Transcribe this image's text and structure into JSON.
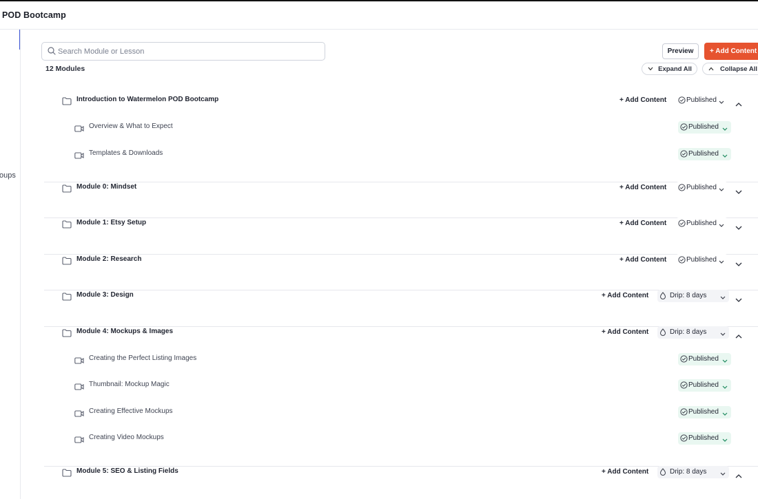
{
  "app": {
    "title": "POD Bootcamp"
  },
  "sidebar": {
    "partial_label": "oups"
  },
  "search": {
    "placeholder": "Search Module or Lesson"
  },
  "toolbar": {
    "preview_label": "Preview",
    "add_content_label": "+ Add Content"
  },
  "list": {
    "count_label": "12 Modules",
    "expand_all_label": "Expand All",
    "collapse_all_label": "Collapse All"
  },
  "colors": {
    "accent": "#e6532f",
    "published_bg": "#e9f7f1",
    "drip_bg": "#f3f4f7",
    "active_nav": "#3c55d6"
  },
  "modules": [
    {
      "title": "Introduction to Watermelon POD Bootcamp",
      "add_label": "+ Add Content",
      "status": "Published",
      "expanded": true,
      "lessons": [
        {
          "title": "Overview & What to Expect",
          "status": "Published"
        },
        {
          "title": "Templates & Downloads",
          "status": "Published"
        }
      ]
    },
    {
      "title": "Module 0: Mindset",
      "add_label": "+ Add Content",
      "status": "Published",
      "expanded": false
    },
    {
      "title": "Module 1: Etsy Setup",
      "add_label": "+ Add Content",
      "status": "Published",
      "expanded": false
    },
    {
      "title": "Module 2: Research",
      "add_label": "+ Add Content",
      "status": "Published",
      "expanded": false
    },
    {
      "title": "Module 3: Design",
      "add_label": "+ Add Content",
      "status": "Drip: 8 days",
      "expanded": false
    },
    {
      "title": "Module 4: Mockups & Images",
      "add_label": "+ Add Content",
      "status": "Drip: 8 days",
      "expanded": true,
      "lessons": [
        {
          "title": "Creating the Perfect Listing Images",
          "status": "Published"
        },
        {
          "title": "Thumbnail: Mockup Magic",
          "status": "Published"
        },
        {
          "title": "Creating Effective Mockups",
          "status": "Published"
        },
        {
          "title": "Creating Video Mockups",
          "status": "Published"
        }
      ]
    },
    {
      "title": "Module 5: SEO & Listing Fields",
      "add_label": "+ Add Content",
      "status": "Drip: 8 days",
      "expanded": true
    }
  ]
}
